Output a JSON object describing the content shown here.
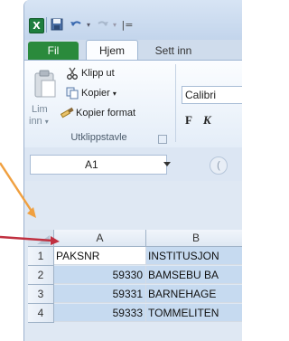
{
  "quick_access": {
    "app_icon": "excel-icon",
    "save_icon": "save-icon",
    "undo_icon": "undo-icon",
    "redo_icon": "redo-icon",
    "customize_icon": "customize-qat-icon",
    "excel_letter": "X",
    "customize_glyph": "|="
  },
  "tabs": {
    "file": "Fil",
    "home": "Hjem",
    "insert": "Sett inn"
  },
  "ribbon": {
    "clipboard": {
      "paste_line1": "Lim",
      "paste_line2": "inn",
      "paste_caret": "▾",
      "cut": "Klipp ut",
      "copy": "Kopier",
      "copy_caret": "▾",
      "format_painter": "Kopier format",
      "group_label": "Utklippstavle"
    },
    "font": {
      "name": "Calibri",
      "bold": "F",
      "italic": "K"
    }
  },
  "formula_bar": {
    "name_box": "A1",
    "fx_label": "("
  },
  "sheet": {
    "columns": [
      "A",
      "B"
    ],
    "rows": [
      {
        "num": "1",
        "a": "PAKSNR",
        "b": "INSTITUSJON"
      },
      {
        "num": "2",
        "a": "59330",
        "b": "BAMSEBU BA"
      },
      {
        "num": "3",
        "a": "59331",
        "b": "BARNEHAGE"
      },
      {
        "num": "4",
        "a": "59333",
        "b": "TOMMELITEN"
      }
    ]
  },
  "annotations": {
    "arrow_orange": "#f0a040",
    "arrow_red": "#c03040"
  },
  "colors": {
    "file_tab": "#2a8a3c",
    "selection": "#c6daf0"
  }
}
